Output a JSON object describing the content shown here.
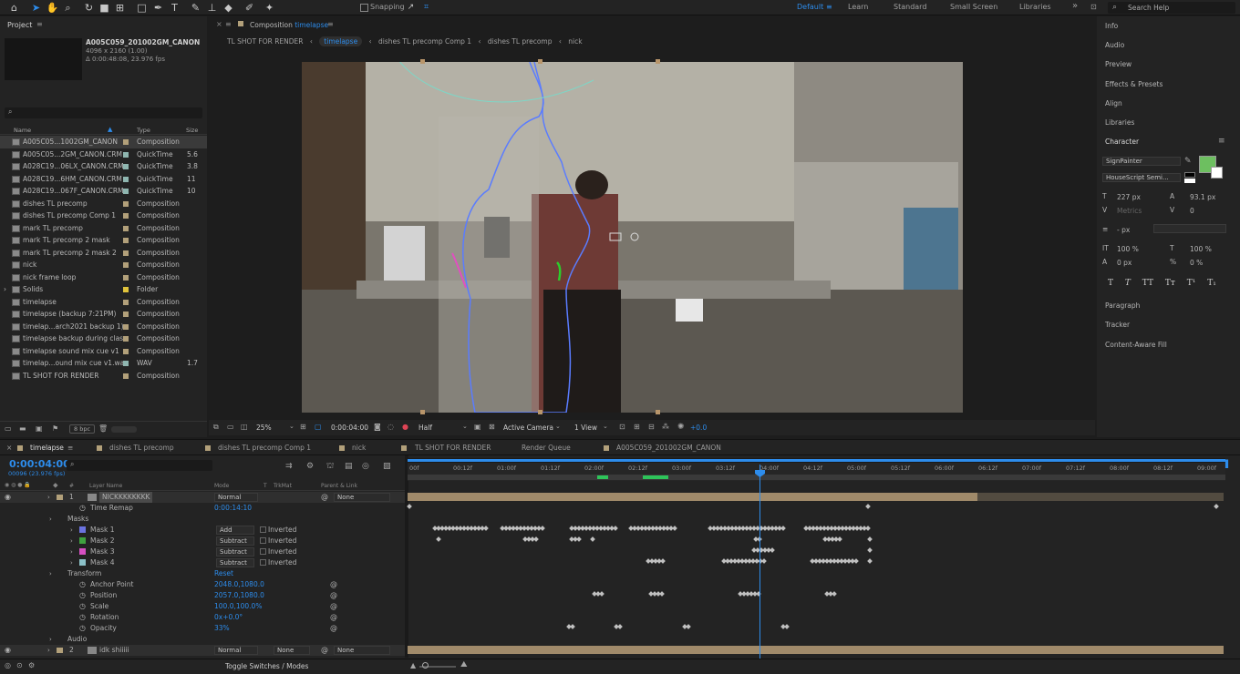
{
  "toolbar": {
    "snapping_label": "Snapping",
    "workspaces": [
      "Default",
      "Learn",
      "Standard",
      "Small Screen",
      "Libraries"
    ],
    "search_placeholder": "Search Help",
    "overflow": "»"
  },
  "project": {
    "title": "Project",
    "selected_name": "A005C059_201002GM_CANON",
    "selected_res": "4096 x 2160 (1.00)",
    "selected_dur": "Δ 0:00:48:08, 23.976 fps",
    "columns": [
      "Name",
      "Type",
      "Size"
    ],
    "bpc": "8 bpc",
    "items": [
      {
        "name": "A005C05...1002GM_CANON",
        "type": "Composition",
        "size": "",
        "color": "#b2a07a"
      },
      {
        "name": "A005C05...2GM_CANON.CRM",
        "type": "QuickTime",
        "size": "5.6",
        "color": "#8fb6b0"
      },
      {
        "name": "A028C19...06LX_CANON.CRM",
        "type": "QuickTime",
        "size": "3.8",
        "color": "#8fb6b0"
      },
      {
        "name": "A028C19...6HM_CANON.CRM",
        "type": "QuickTime",
        "size": "11",
        "color": "#8fb6b0"
      },
      {
        "name": "A028C19...067F_CANON.CRM",
        "type": "QuickTime",
        "size": "10",
        "color": "#8fb6b0"
      },
      {
        "name": "dishes TL precomp",
        "type": "Composition",
        "size": "",
        "color": "#b2a07a"
      },
      {
        "name": "dishes TL precomp Comp 1",
        "type": "Composition",
        "size": "",
        "color": "#b2a07a"
      },
      {
        "name": "mark TL precomp",
        "type": "Composition",
        "size": "",
        "color": "#b2a07a"
      },
      {
        "name": "mark TL precomp 2 mask",
        "type": "Composition",
        "size": "",
        "color": "#b2a07a"
      },
      {
        "name": "mark TL precomp 2 mask 2",
        "type": "Composition",
        "size": "",
        "color": "#b2a07a"
      },
      {
        "name": "nick",
        "type": "Composition",
        "size": "",
        "color": "#b2a07a"
      },
      {
        "name": "nick frame loop",
        "type": "Composition",
        "size": "",
        "color": "#b2a07a"
      },
      {
        "name": "Solids",
        "type": "Folder",
        "size": "",
        "color": "#e0c33b"
      },
      {
        "name": "timelapse",
        "type": "Composition",
        "size": "",
        "color": "#b2a07a"
      },
      {
        "name": "timelapse (backup 7:21PM)",
        "type": "Composition",
        "size": "",
        "color": "#b2a07a"
      },
      {
        "name": "timelap...arch2021 backup 1)",
        "type": "Composition",
        "size": "",
        "color": "#b2a07a"
      },
      {
        "name": "timelapse backup during class",
        "type": "Composition",
        "size": "",
        "color": "#b2a07a"
      },
      {
        "name": "timelapse sound mix cue v1",
        "type": "Composition",
        "size": "",
        "color": "#b2a07a"
      },
      {
        "name": "timelap...ound mix cue v1.wav",
        "type": "WAV",
        "size": "1.7",
        "color": "#8fb6b0"
      },
      {
        "name": "TL SHOT FOR RENDER",
        "type": "Composition",
        "size": "",
        "color": "#b2a07a"
      }
    ]
  },
  "composition": {
    "header_prefix": "Composition",
    "header_name": "timelapse",
    "breadcrumbs": [
      "TL SHOT FOR RENDER",
      "timelapse",
      "dishes TL precomp Comp 1",
      "dishes TL precomp",
      "nick"
    ],
    "zoom": "25%",
    "timecode": "0:00:04:00",
    "resolution": "Half",
    "camera": "Active Camera",
    "views": "1 View",
    "exposure": "+0.0"
  },
  "right_panels": {
    "top": [
      "Info",
      "Audio",
      "Preview",
      "Effects & Presets",
      "Align",
      "Libraries"
    ],
    "character_title": "Character",
    "font_family": "SignPainter",
    "font_style": "HouseScript Semi...",
    "font_size": "227 px",
    "leading": "93.1 px",
    "kerning": "Metrics",
    "tracking": "0",
    "stroke": "- px",
    "vscale": "100 %",
    "hscale": "100 %",
    "baseline": "0 px",
    "tsume": "0 %",
    "type_buttons": [
      "T",
      "T",
      "TT",
      "Tт",
      "T¹",
      "T₁"
    ],
    "fill_color": "#6dbf60",
    "bottom": [
      "Paragraph",
      "Tracker",
      "Content-Aware Fill"
    ]
  },
  "timeline": {
    "tabs": [
      "timelapse",
      "dishes TL precomp",
      "dishes TL precomp Comp 1",
      "nick",
      "TL SHOT FOR RENDER",
      "Render Queue",
      "A005C059_201002GM_CANON"
    ],
    "current_time": "0:00:04:00",
    "frame_info": "00096 (23.976 fps)",
    "col_headers": [
      "#",
      "Layer Name",
      "Mode",
      "T",
      "TrkMat",
      "Parent & Link"
    ],
    "ruler": [
      "00f",
      "00:12f",
      "01:00f",
      "01:12f",
      "02:00f",
      "02:12f",
      "03:00f",
      "03:12f",
      "04:00f",
      "04:12f",
      "05:00f",
      "05:12f",
      "06:00f",
      "06:12f",
      "07:00f",
      "07:12f",
      "08:00f",
      "08:12f",
      "09:00f"
    ],
    "rows": [
      {
        "label": "1",
        "name": "NICKKKKKKKK",
        "mode": "Normal",
        "parent": "None",
        "kind": "layer"
      },
      {
        "name": "Time Remap",
        "value": "0:00:14:10",
        "kind": "prop"
      },
      {
        "name": "Masks",
        "kind": "group"
      },
      {
        "name": "Mask 1",
        "mode": "Add",
        "inv": "Inverted",
        "color": "#6b73e0",
        "kind": "mask"
      },
      {
        "name": "Mask 2",
        "mode": "Subtract",
        "inv": "Inverted",
        "color": "#3fa13f",
        "kind": "mask"
      },
      {
        "name": "Mask 3",
        "mode": "Subtract",
        "inv": "Inverted",
        "color": "#d64fc2",
        "kind": "mask"
      },
      {
        "name": "Mask 4",
        "mode": "Subtract",
        "inv": "Inverted",
        "color": "#8cc1c8",
        "kind": "mask"
      },
      {
        "name": "Transform",
        "value": "Reset",
        "kind": "group"
      },
      {
        "name": "Anchor Point",
        "value": "2048.0,1080.0",
        "kind": "prop"
      },
      {
        "name": "Position",
        "value": "2057.0,1080.0",
        "kind": "prop"
      },
      {
        "name": "Scale",
        "value": "100.0,100.0%",
        "kind": "prop"
      },
      {
        "name": "Rotation",
        "value": "0x+0.0°",
        "kind": "prop"
      },
      {
        "name": "Opacity",
        "value": "33%",
        "kind": "prop"
      },
      {
        "name": "Audio",
        "kind": "group"
      },
      {
        "label": "2",
        "name": "idk shiiiii",
        "mode": "Normal",
        "trkmat": "None",
        "parent": "None",
        "kind": "layer"
      }
    ],
    "footer": "Toggle Switches / Modes"
  }
}
